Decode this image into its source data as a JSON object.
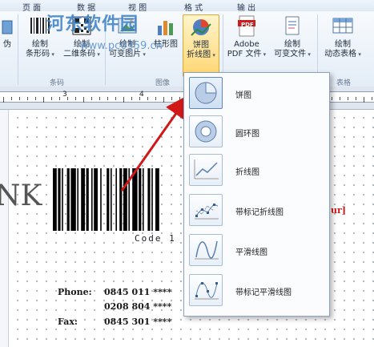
{
  "menu": {
    "tabs": [
      "页 面",
      "数 据",
      "视 图",
      "格 式",
      "输 出"
    ]
  },
  "watermark": {
    "title": "河东软件园",
    "url": "www.pc0359.cn"
  },
  "ribbon": {
    "partial_left": "伪",
    "barcode_btn": {
      "line1": "绘制",
      "line2": "条形码"
    },
    "qrcode_btn": {
      "line1": "绘制",
      "line2": "二维条码"
    },
    "image_btn": {
      "line1": "绘制",
      "line2": "可变图片"
    },
    "bar_btn": {
      "line1": "柱形图"
    },
    "pie_btn": {
      "line1": "饼图",
      "line2": "折线图"
    },
    "pdf_btn": {
      "line1": "Adobe",
      "line2": "PDF 文件",
      "icon_text": "PDF"
    },
    "varfile_btn": {
      "line1": "绘制",
      "line2": "可变文件"
    },
    "dyntable_btn": {
      "line1": "绘制",
      "line2": "动态表格"
    },
    "groups": {
      "barcode": "条码",
      "image": "图像",
      "table": "表格"
    }
  },
  "ruler": {
    "marks": [
      "3",
      "4"
    ]
  },
  "canvas": {
    "partial_text": "NK",
    "barcode_caption": "Code 1",
    "red_fragment": "ur]",
    "contact": [
      {
        "label": "Phone:",
        "value": "0845 011 ****"
      },
      {
        "label": "",
        "value": "0208 804 ****"
      },
      {
        "label": "Fax:",
        "value": "0845 301 ****"
      }
    ]
  },
  "dropdown": {
    "items": [
      {
        "label": "饼图",
        "icon": "pie-chart-icon"
      },
      {
        "label": "圆环图",
        "icon": "donut-chart-icon"
      },
      {
        "label": "折线图",
        "icon": "line-chart-icon"
      },
      {
        "label": "带标记折线图",
        "icon": "marker-line-chart-icon"
      },
      {
        "label": "平滑线图",
        "icon": "smooth-line-chart-icon"
      },
      {
        "label": "带标记平滑线图",
        "icon": "marker-smooth-line-chart-icon"
      }
    ]
  },
  "colors": {
    "accent_red": "#d01818",
    "ribbon_blue": "#e4edf7",
    "watermark_blue": "#3a7fc8"
  }
}
